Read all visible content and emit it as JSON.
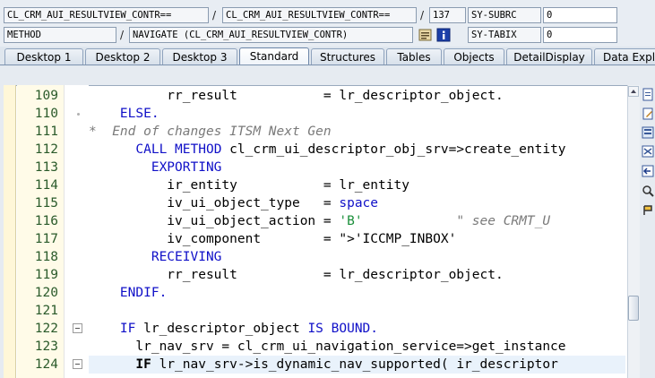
{
  "info_fields": {
    "program": "CL_CRM_AUI_RESULTVIEW_CONTR==",
    "include": "CL_CRM_AUI_RESULTVIEW_CONTR==",
    "line": "137",
    "var1_name": "SY-SUBRC",
    "var1_value": "0",
    "kind": "METHOD",
    "event": "NAVIGATE (CL_CRM_AUI_RESULTVIEW_CONTR)",
    "var2_name": "SY-TABIX",
    "var2_value": "0",
    "separator": "/"
  },
  "tabs": [
    {
      "label": "Desktop 1"
    },
    {
      "label": "Desktop 2"
    },
    {
      "label": "Desktop 3"
    },
    {
      "label": "Standard"
    },
    {
      "label": "Structures"
    },
    {
      "label": "Tables"
    },
    {
      "label": "Objects"
    },
    {
      "label": "DetailDisplay"
    },
    {
      "label": "Data Explo"
    }
  ],
  "active_tab": "Standard",
  "code_lines": [
    {
      "num": "109",
      "text": "          rr_result           = lr_descriptor_object."
    },
    {
      "num": "110",
      "text": "    ELSE."
    },
    {
      "num": "111",
      "text": "*  End of changes ITSM Next Gen"
    },
    {
      "num": "112",
      "text": "      CALL METHOD cl_crm_ui_descriptor_obj_srv=>create_entity"
    },
    {
      "num": "113",
      "text": "        EXPORTING"
    },
    {
      "num": "114",
      "text": "          ir_entity           = lr_entity"
    },
    {
      "num": "115",
      "text": "          iv_ui_object_type   = space"
    },
    {
      "num": "116",
      "text": "          iv_ui_object_action = 'B'            \" see CRMT_U"
    },
    {
      "num": "117",
      "text": "          iv_component        = 'ICCMP_INBOX'"
    },
    {
      "num": "118",
      "text": "        RECEIVING"
    },
    {
      "num": "119",
      "text": "          rr_result           = lr_descriptor_object."
    },
    {
      "num": "120",
      "text": "    ENDIF."
    },
    {
      "num": "121",
      "text": ""
    },
    {
      "num": "122",
      "text": "    IF lr_descriptor_object IS BOUND."
    },
    {
      "num": "123",
      "text": "      lr_nav_srv = cl_crm_ui_navigation_service=>get_instance"
    },
    {
      "num": "124",
      "text": "      IF lr_nav_srv->is_dynamic_nav_supported( ir_descriptor"
    }
  ],
  "colors": {
    "keyword": "#1010c8",
    "string": "#1a8f3a",
    "comment": "#7a7a7a",
    "line_number": "#2a5a2a"
  },
  "icons": {
    "source_icon": "source-icon",
    "info_icon": "info-icon",
    "toolbar": [
      "new-doc-icon",
      "edit-doc-icon",
      "display-icon",
      "compare-icon",
      "search-icon",
      "stop-icon"
    ]
  }
}
